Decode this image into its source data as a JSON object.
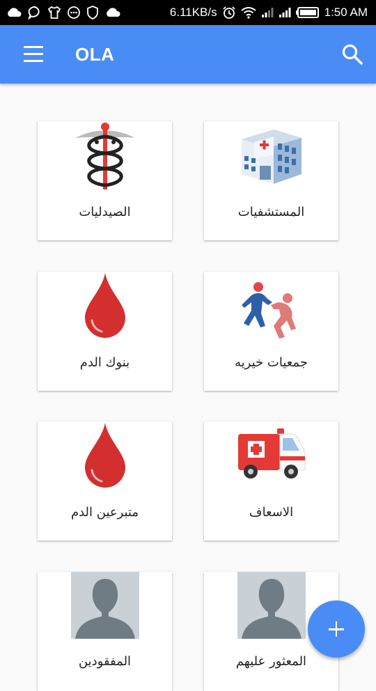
{
  "status_bar": {
    "network_speed": "6.11KB/s",
    "time": "1:50 AM",
    "notification_icons": [
      "cloud-icon",
      "chat-bubble-icon",
      "shirt-icon",
      "message-dots-icon",
      "shield-icon",
      "cloud-icon"
    ],
    "system_icons": [
      "alarm-icon",
      "wifi-icon",
      "signal-icon",
      "signal-icon",
      "battery-icon"
    ]
  },
  "app_bar": {
    "title": "OLA",
    "menu_icon": "menu-icon",
    "search_icon": "search-icon",
    "color": "#4a8cf5"
  },
  "grid": {
    "cards": [
      {
        "label": "المستشفيات",
        "icon": "hospital-building-icon"
      },
      {
        "label": "الصيدليات",
        "icon": "caduceus-icon"
      },
      {
        "label": "جمعيات خيريه",
        "icon": "helping-people-icon"
      },
      {
        "label": "بنوك الدم",
        "icon": "blood-drop-icon"
      },
      {
        "label": "الاسعاف",
        "icon": "ambulance-icon"
      },
      {
        "label": "متبرعين الدم",
        "icon": "blood-drop-icon"
      },
      {
        "label": "المعثور عليهم",
        "icon": "person-silhouette-icon"
      },
      {
        "label": "المفقودين",
        "icon": "person-silhouette-icon"
      }
    ]
  },
  "fab": {
    "icon": "plus-icon",
    "color": "#4a8cf5"
  },
  "colors": {
    "blood_red": "#d32f2f",
    "background": "#fafafa"
  }
}
